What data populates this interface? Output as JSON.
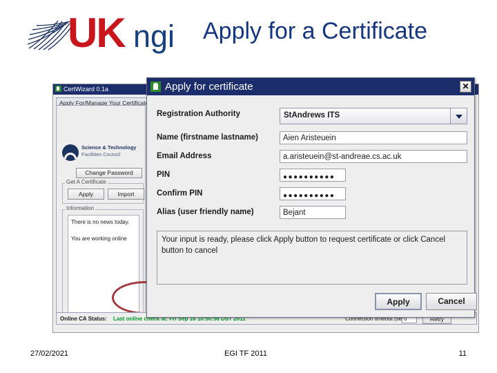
{
  "slide": {
    "title": "Apply for a Certificate",
    "logo": {
      "mark": "uk-ngi-mesh-logo",
      "text_uk": "UK",
      "text_ngi": "ngi"
    },
    "footer": {
      "date": "27/02/2021",
      "event": "EGI TF 2011",
      "page": "11"
    }
  },
  "app_window": {
    "title": "CertWizard 0.1a",
    "title_icon": "java-app-icon",
    "tab_label": "Apply For/Manage Your Certificate",
    "org_logo": {
      "icon": "stfc-roundel-icon",
      "line1": "Science & Technology",
      "line2": "Facilities Council"
    },
    "change_password_label": "Change Password",
    "get_certificate_group": "Get A Certificate",
    "apply_label": "Apply",
    "import_label": "Import",
    "information_group": "Information",
    "information_line1": "There is no news today.",
    "information_line2": "You are working online",
    "statusbar": {
      "label": "Online CA Status:",
      "value": "Last online check at: Fri Sep 16 10:50:56 DST 2011",
      "value_color": "#009a28",
      "timeout_label": "Connection timeout (secs)",
      "timeout_value": "0",
      "retry_label": "Retry"
    },
    "annotation": "red-ellipse-highlight-apply"
  },
  "dialog": {
    "title": "Apply for certificate",
    "title_icon": "java-app-icon",
    "close_label": "✕",
    "fields": [
      {
        "label": "Registration Authority",
        "value": "StAndrews ITS",
        "type": "combobox"
      },
      {
        "label": "Name (firstname lastname)",
        "value": "Aien Aristeuein",
        "type": "text"
      },
      {
        "label": "Email Address",
        "value": "a.aristeuein@st-andreae.cs.ac.uk",
        "type": "text"
      },
      {
        "label": "PIN",
        "value": "●●●●●●●●●●",
        "type": "password"
      },
      {
        "label": "Confirm PIN",
        "value": "●●●●●●●●●●",
        "type": "password"
      },
      {
        "label": "Alias (user friendly name)",
        "value": "Bejant",
        "type": "text"
      }
    ],
    "status_message": "Your input is ready, please click Apply button to request certificate or click Cancel button to cancel",
    "apply_label": "Apply",
    "cancel_label": "Cancel",
    "accent_color": "#1c2d6b"
  }
}
